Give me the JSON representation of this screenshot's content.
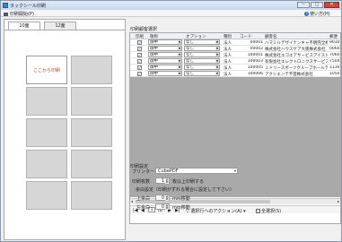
{
  "window": {
    "title": "タックシール印刷",
    "minimize": "─",
    "maximize": "□",
    "close": "✕"
  },
  "menu": {
    "print": "印刷開始(P)",
    "help": "使い方(H)",
    "help_glyph": "?"
  },
  "tabs": [
    "10面",
    "12面"
  ],
  "cell_label": "ここから印刷",
  "right": {
    "title": "印刷顧客選択"
  },
  "grid": {
    "headers": [
      "印刷",
      "敬称",
      "オプション",
      "種別",
      "コード",
      "顧客名",
      "郵便"
    ],
    "rows": [
      {
        "checked": "✓",
        "keisho": "御中",
        "option": "なし",
        "type": "法人",
        "code": "00001",
        "name": "ハマミルデザイナンキャ不明完全株式会社",
        "zip": "9030"
      },
      {
        "checked": "✓",
        "keisho": "御中",
        "option": "なし",
        "type": "法人",
        "code": "00002",
        "name": "株式会社ハウスケア大阪株式会社",
        "zip": "0060"
      },
      {
        "checked": "✓",
        "keisho": "御中",
        "option": "なし",
        "type": "法人",
        "code": "100001",
        "name": "株式会社エコエアサービスアイスドリン…",
        "zip": "7060"
      },
      {
        "checked": "✓",
        "keisho": "御中",
        "option": "なし",
        "type": "法人",
        "code": "100003",
        "name": "有限会社エレクトロニクスサービスアイスアイエネ",
        "zip": "7504"
      },
      {
        "checked": "✓",
        "keisho": "御中",
        "option": "なし",
        "type": "法人",
        "code": "100005",
        "name": "ミドリースポーツグループホールディングス外株…",
        "zip": "1130"
      },
      {
        "checked": "✓",
        "keisho": "御中",
        "option": "なし",
        "type": "法人",
        "code": "100006",
        "name": "アクシエンテ不芸株式会社",
        "zip": "1050"
      }
    ]
  },
  "navigator": {
    "first": "|◀",
    "prev": "◀",
    "page": "1",
    "of": "/6",
    "next": "▶",
    "last": "▶|",
    "action_filter": "▽ 選択行へのアクション(A) ▾",
    "select_all": "全選択(S)"
  },
  "settings": {
    "title": "印刷設定",
    "printer_label": "プリンター：",
    "printer_value": "CubePDF",
    "copies_label": "印刷枚数",
    "copies_value": "1",
    "copies_suffix": "枚以上印刷する",
    "offset_label": "余白設定（印刷がずれる場合に設定して下さい）",
    "top_label": "上余白",
    "top_value": "0",
    "top_unit": "mm移動",
    "left_label": "左余白",
    "left_value": "0",
    "left_unit": "mm移動"
  },
  "colors": {
    "accent_label": "#c0392b",
    "grid_empty": "#a9a9a9"
  }
}
